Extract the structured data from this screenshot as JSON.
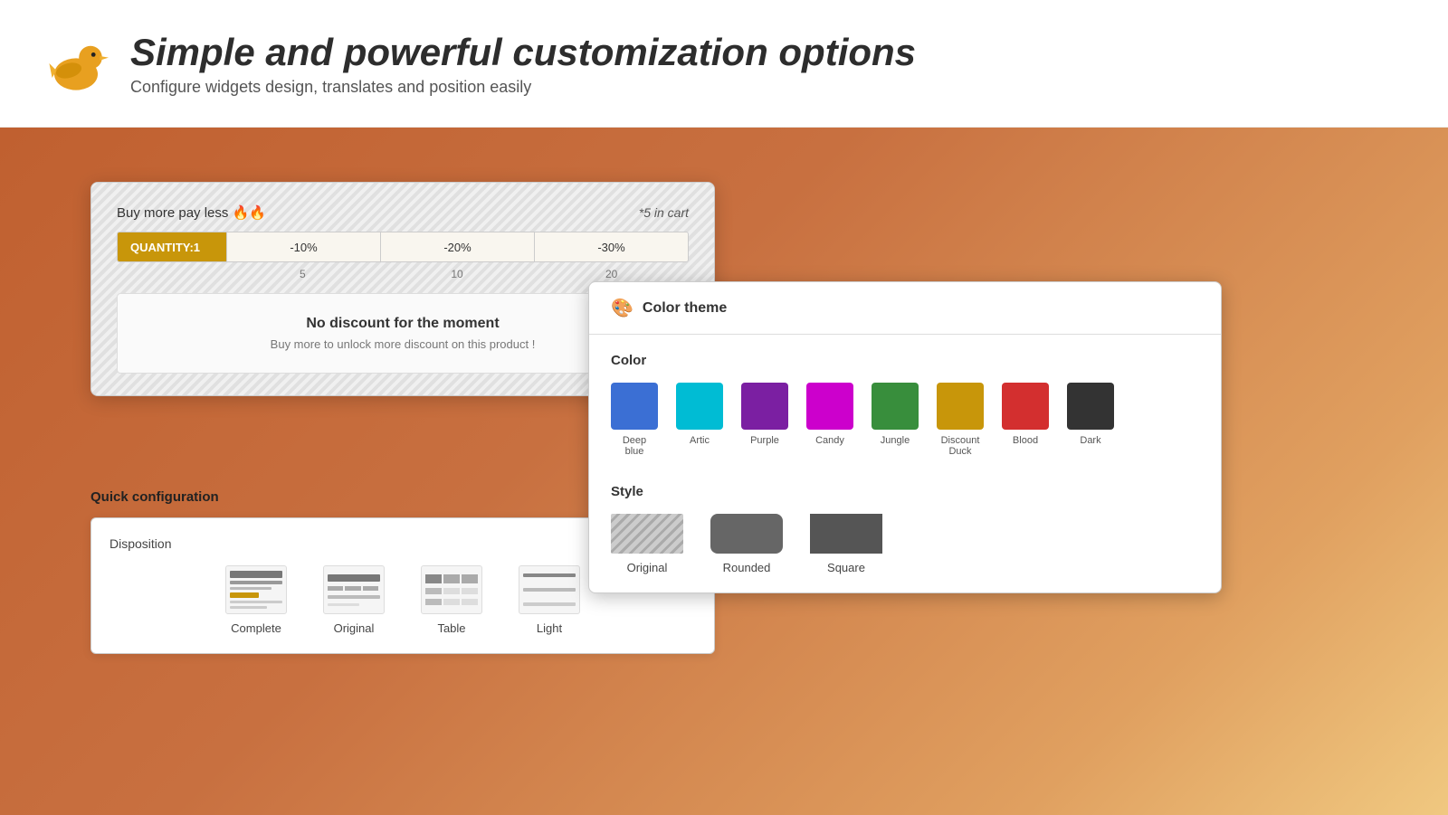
{
  "header": {
    "title": "Simple and powerful customization options",
    "subtitle": "Configure widgets design, translates and position easily"
  },
  "widget_preview": {
    "buy_more_title": "Buy more pay less 🔥🔥",
    "in_cart": "*5 in cart",
    "quantity_label": "QUANTITY:1",
    "segments": [
      "-10%",
      "-20%",
      "-30%"
    ],
    "labels": [
      "5",
      "10",
      "20"
    ],
    "no_discount_title": "No discount for the moment",
    "no_discount_sub": "Buy more to unlock more discount on this product !"
  },
  "quick_config": {
    "title": "Quick configuration",
    "disposition_title": "Disposition",
    "options": [
      {
        "label": "Complete"
      },
      {
        "label": "Original"
      },
      {
        "label": "Table"
      },
      {
        "label": "Light"
      }
    ]
  },
  "color_theme": {
    "title": "Color theme",
    "color_section": "Color",
    "colors": [
      {
        "name": "Deep blue",
        "hex": "#3b6fd4"
      },
      {
        "name": "Artic",
        "hex": "#00bcd4"
      },
      {
        "name": "Purple",
        "hex": "#7b1fa2"
      },
      {
        "name": "Candy",
        "hex": "#cc00cc"
      },
      {
        "name": "Jungle",
        "hex": "#388e3c"
      },
      {
        "name": "Discount Duck",
        "hex": "#c8960a"
      },
      {
        "name": "Blood",
        "hex": "#d32f2f"
      },
      {
        "name": "Dark",
        "hex": "#333333"
      }
    ],
    "style_section": "Style",
    "styles": [
      {
        "name": "Original"
      },
      {
        "name": "Rounded"
      },
      {
        "name": "Square"
      }
    ]
  }
}
